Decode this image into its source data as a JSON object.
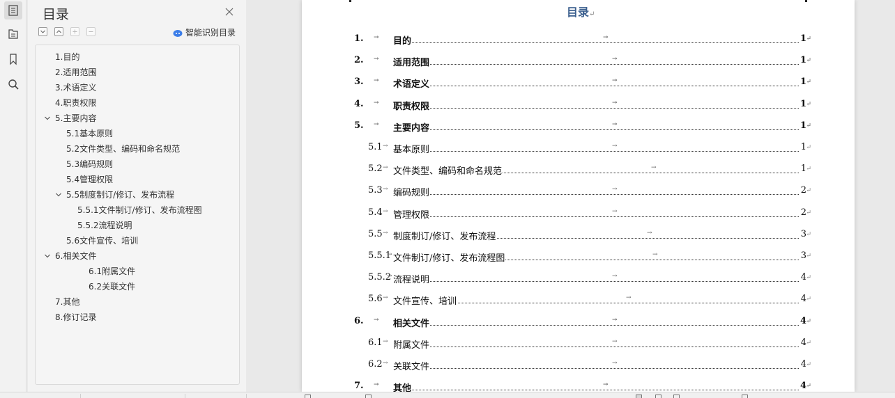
{
  "nav_panel": {
    "title": "目录",
    "smart_label": "智能识别目录",
    "items": [
      {
        "label": "1.目的"
      },
      {
        "label": "2.适用范围"
      },
      {
        "label": "3.术语定义"
      },
      {
        "label": "4.职责权限"
      },
      {
        "label": "5.主要内容"
      },
      {
        "label": "5.1基本原则"
      },
      {
        "label": "5.2文件类型、编码和命名规范"
      },
      {
        "label": "5.3编码规则"
      },
      {
        "label": "5.4管理权限"
      },
      {
        "label": "5.5制度制订/修订、发布流程"
      },
      {
        "label": "5.5.1文件制订/修订、发布流程图"
      },
      {
        "label": "5.5.2流程说明"
      },
      {
        "label": "5.6文件宣传、培训"
      },
      {
        "label": "6.相关文件"
      },
      {
        "label": "6.1附属文件"
      },
      {
        "label": "6.2关联文件"
      },
      {
        "label": "7.其他"
      },
      {
        "label": "8.修订记录"
      }
    ]
  },
  "document": {
    "title": "目录",
    "para_mark": "↵",
    "tab_mark": "→",
    "entries": [
      {
        "num": "1.",
        "text": "目的",
        "page": "1"
      },
      {
        "num": "2.",
        "text": "适用范围",
        "page": "1"
      },
      {
        "num": "3.",
        "text": "术语定义",
        "page": "1"
      },
      {
        "num": "4.",
        "text": "职责权限",
        "page": "1"
      },
      {
        "num": "5.",
        "text": "主要内容",
        "page": "1"
      },
      {
        "num": "5.1",
        "text": "基本原则",
        "page": "1"
      },
      {
        "num": "5.2",
        "text": "文件类型、编码和命名规范",
        "page": "1"
      },
      {
        "num": "5.3",
        "text": "编码规则",
        "page": "2"
      },
      {
        "num": "5.4",
        "text": "管理权限",
        "page": "2"
      },
      {
        "num": "5.5",
        "text": "制度制订/修订、发布流程",
        "page": "3"
      },
      {
        "num": "5.5.1",
        "text": "文件制订/修订、发布流程图",
        "page": "3"
      },
      {
        "num": "5.5.2",
        "text": "流程说明",
        "page": "4"
      },
      {
        "num": "5.6",
        "text": "文件宣传、培训",
        "page": "4"
      },
      {
        "num": "6.",
        "text": "相关文件",
        "page": "4"
      },
      {
        "num": "6.1",
        "text": "附属文件",
        "page": "4"
      },
      {
        "num": "6.2",
        "text": "关联文件",
        "page": "4"
      },
      {
        "num": "7.",
        "text": "其他",
        "page": "4"
      }
    ]
  },
  "icons": {
    "rail": [
      "toc-icon",
      "outline-icon",
      "bookmark-icon",
      "search-icon"
    ],
    "close": "close-icon",
    "smart": "cloud-icon"
  },
  "colors": {
    "doc_title": "#3b5f8e",
    "panel_bg": "#f3f3f3",
    "smart_icon": "#3b7de8"
  }
}
